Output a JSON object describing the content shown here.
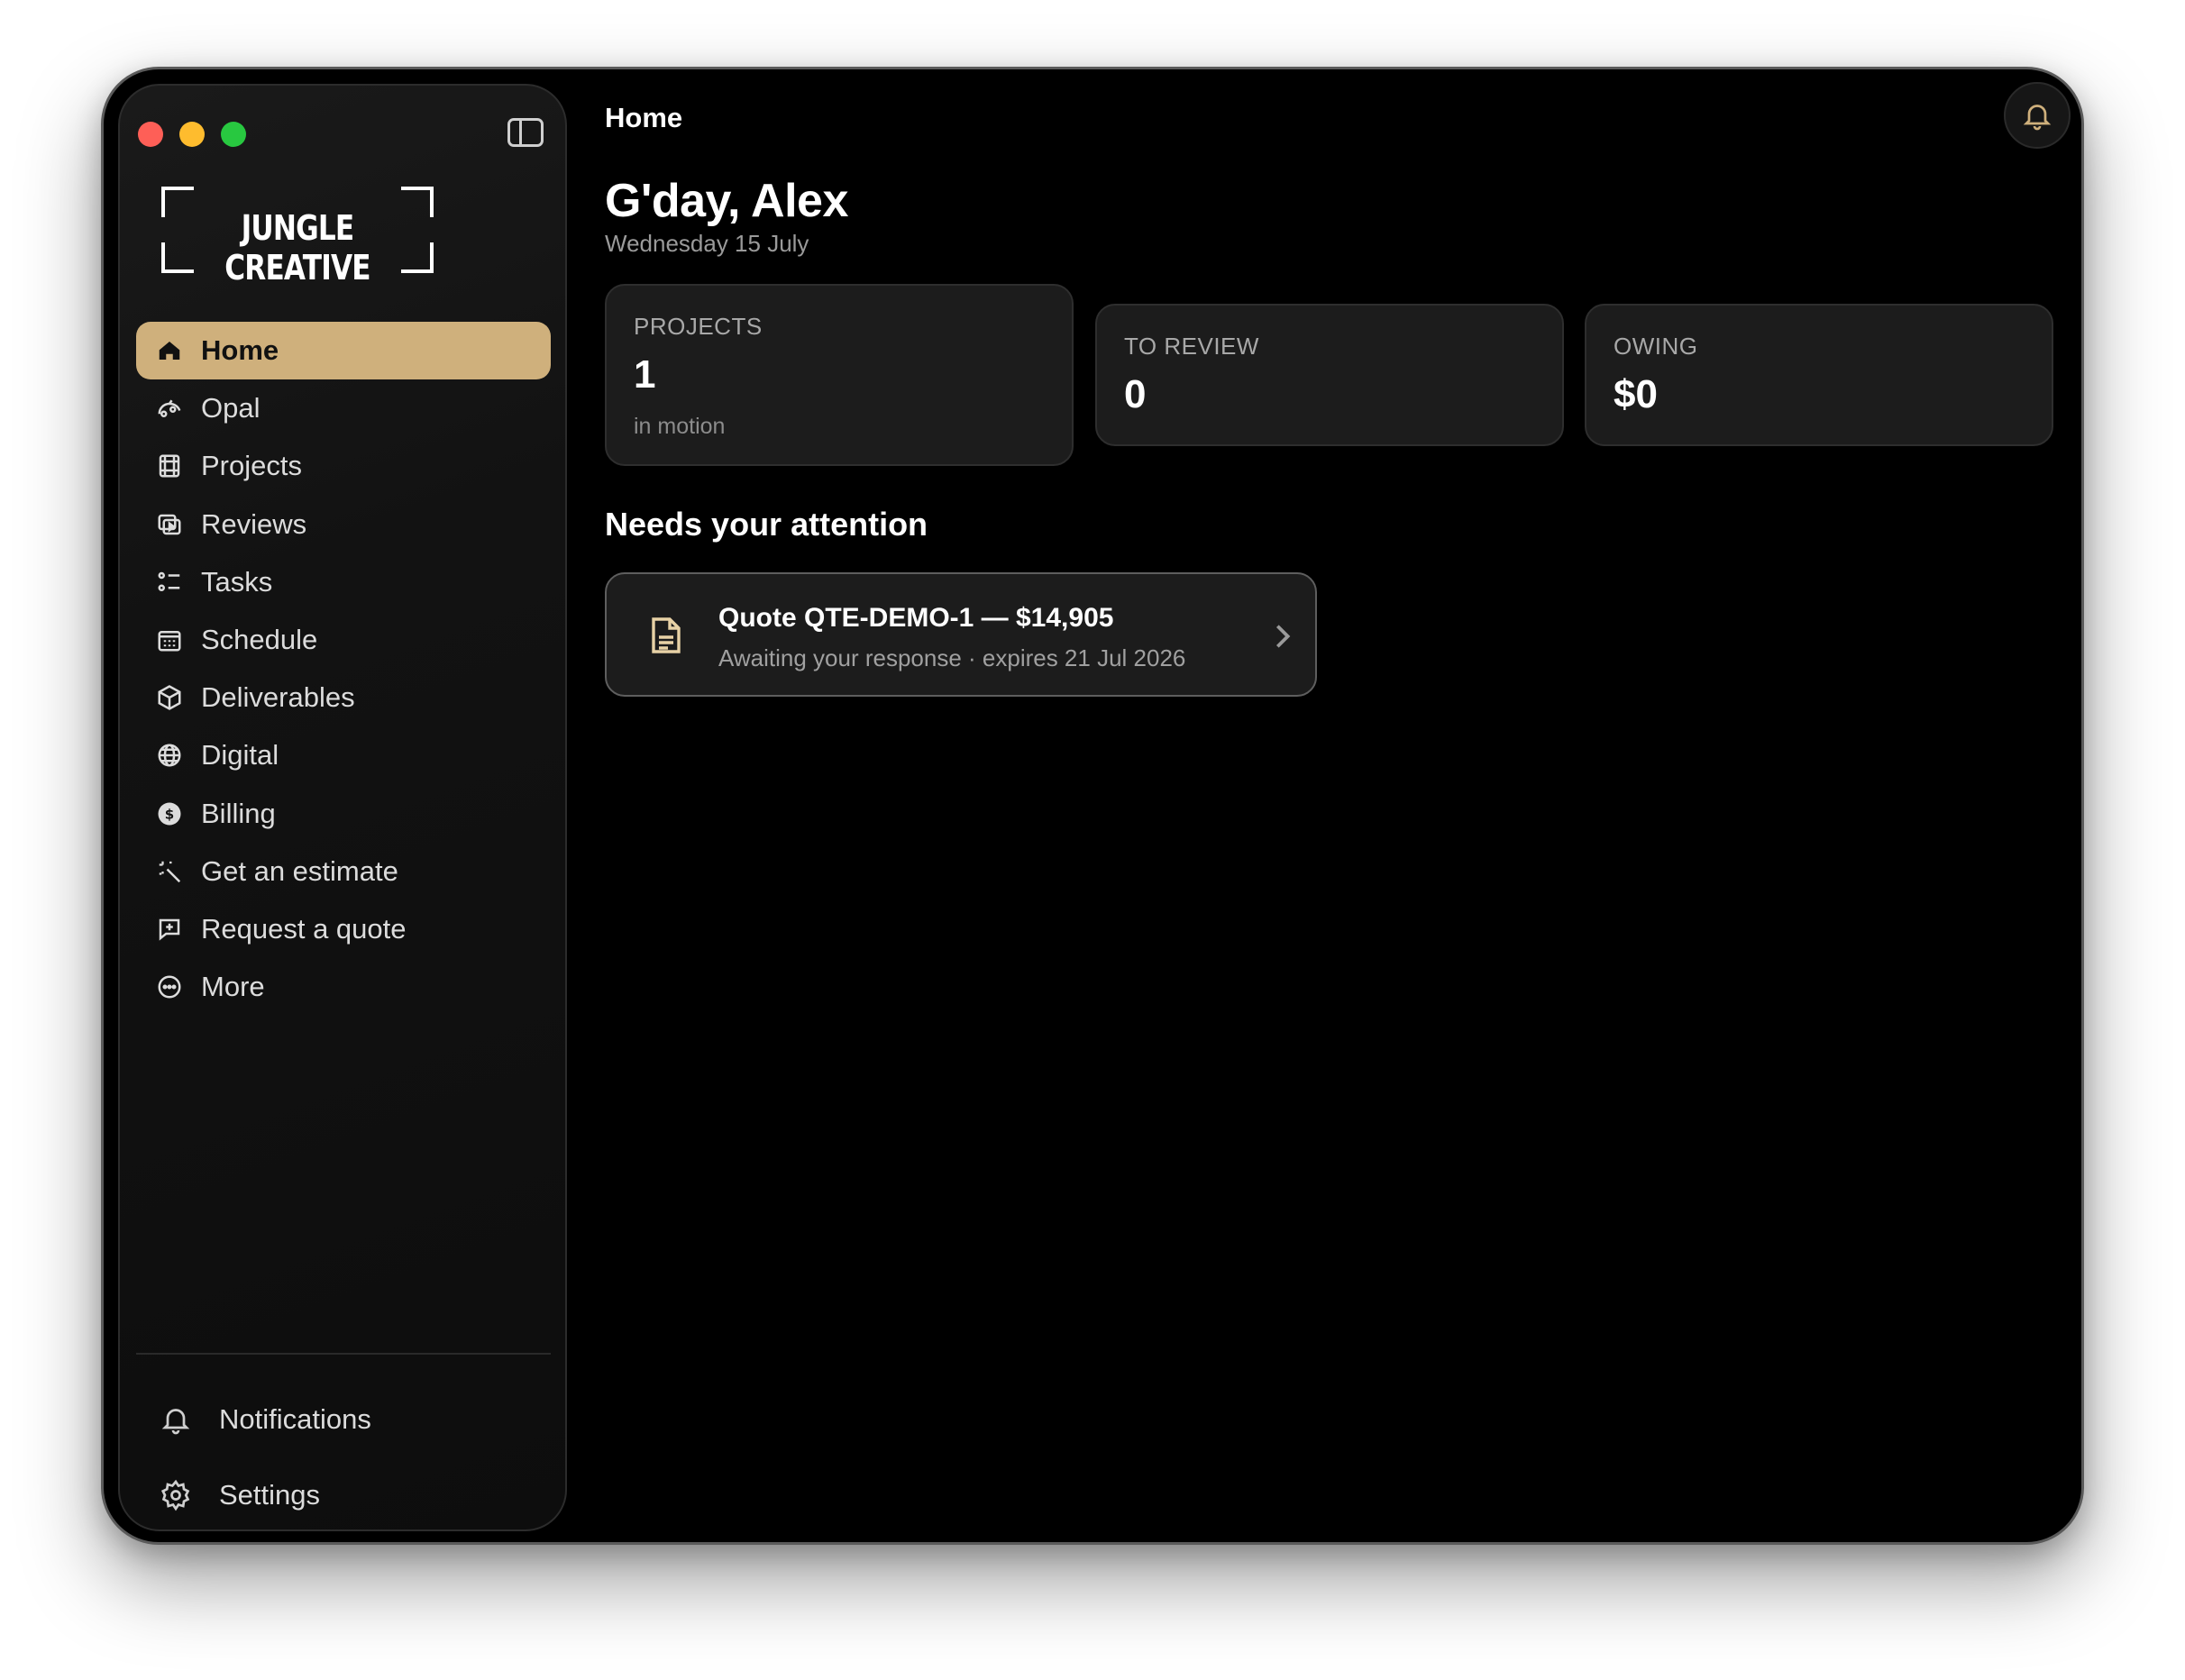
{
  "app": {
    "logo_text": "JUNGLE CREATIVE"
  },
  "sidebar": {
    "items": [
      {
        "label": "Home",
        "icon": "home-icon",
        "active": true
      },
      {
        "label": "Opal",
        "icon": "opal-icon"
      },
      {
        "label": "Projects",
        "icon": "film-icon"
      },
      {
        "label": "Reviews",
        "icon": "review-icon"
      },
      {
        "label": "Tasks",
        "icon": "tasks-icon"
      },
      {
        "label": "Schedule",
        "icon": "calendar-icon"
      },
      {
        "label": "Deliverables",
        "icon": "box-icon"
      },
      {
        "label": "Digital",
        "icon": "globe-icon"
      },
      {
        "label": "Billing",
        "icon": "dollar-icon"
      },
      {
        "label": "Get an estimate",
        "icon": "magic-wand-icon"
      },
      {
        "label": "Request a quote",
        "icon": "message-plus-icon"
      },
      {
        "label": "More",
        "icon": "more-icon"
      }
    ],
    "bottom": {
      "notifications": "Notifications",
      "settings": "Settings"
    }
  },
  "header": {
    "title": "Home"
  },
  "main": {
    "greeting": "G'day, Alex",
    "date": "Wednesday 15 July",
    "stats": {
      "projects": {
        "label": "PROJECTS",
        "value": "1",
        "sub": "in motion"
      },
      "to_review": {
        "label": "TO REVIEW",
        "value": "0"
      },
      "owing": {
        "label": "OWING",
        "value": "$0"
      }
    },
    "attention": {
      "title": "Needs your attention",
      "items": [
        {
          "title": "Quote QTE-DEMO-1 — $14,905",
          "subtitle": "Awaiting your response · expires 21 Jul 2026"
        }
      ]
    }
  },
  "colors": {
    "accent": "#cfb07c",
    "background": "#000000",
    "card": "#1c1c1c"
  }
}
